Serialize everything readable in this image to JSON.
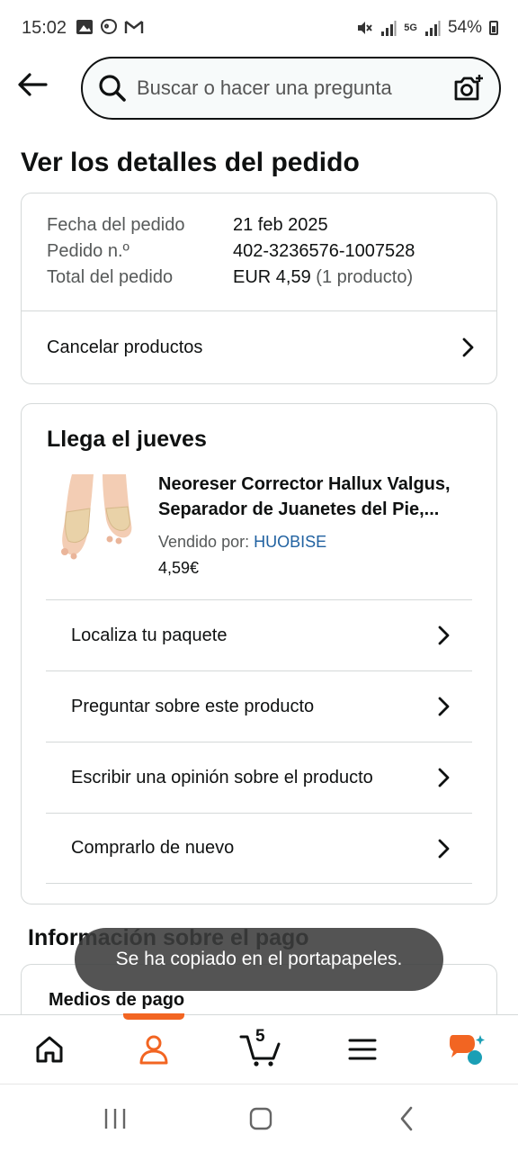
{
  "status_bar": {
    "time": "15:02",
    "battery": "54%",
    "network": "5G"
  },
  "search": {
    "placeholder": "Buscar o hacer una pregunta"
  },
  "page": {
    "title": "Ver los detalles del pedido"
  },
  "summary": {
    "rows": [
      {
        "label": "Fecha del pedido",
        "value": "21 feb 2025"
      },
      {
        "label": "Pedido n.º",
        "value": "402-3236576-1007528"
      },
      {
        "label": "Total del pedido",
        "value": "EUR 4,59",
        "extra": "(1 producto)"
      }
    ],
    "cancel_label": "Cancelar productos"
  },
  "delivery": {
    "title": "Llega el jueves",
    "product": {
      "title": "Neoreser Corrector Hallux Valgus, Separador de Juanetes del Pie,...",
      "seller_prefix": "Vendido por:",
      "seller": "HUOBISE",
      "price": "4,59€"
    },
    "actions": [
      "Localiza tu paquete",
      "Preguntar sobre este producto",
      "Escribir una opinión sobre el producto",
      "Comprarlo de nuevo"
    ]
  },
  "payment": {
    "section_title": "Información sobre el pago",
    "methods_label": "Medios de pago"
  },
  "toast": {
    "message": "Se ha copiado en el portapapeles."
  },
  "bottom_nav": {
    "cart_count": "5",
    "active": "account",
    "accent_color": "#f26522"
  },
  "colors": {
    "link": "#2162a1",
    "border": "#d5d9d9",
    "muted_text": "#565959"
  }
}
